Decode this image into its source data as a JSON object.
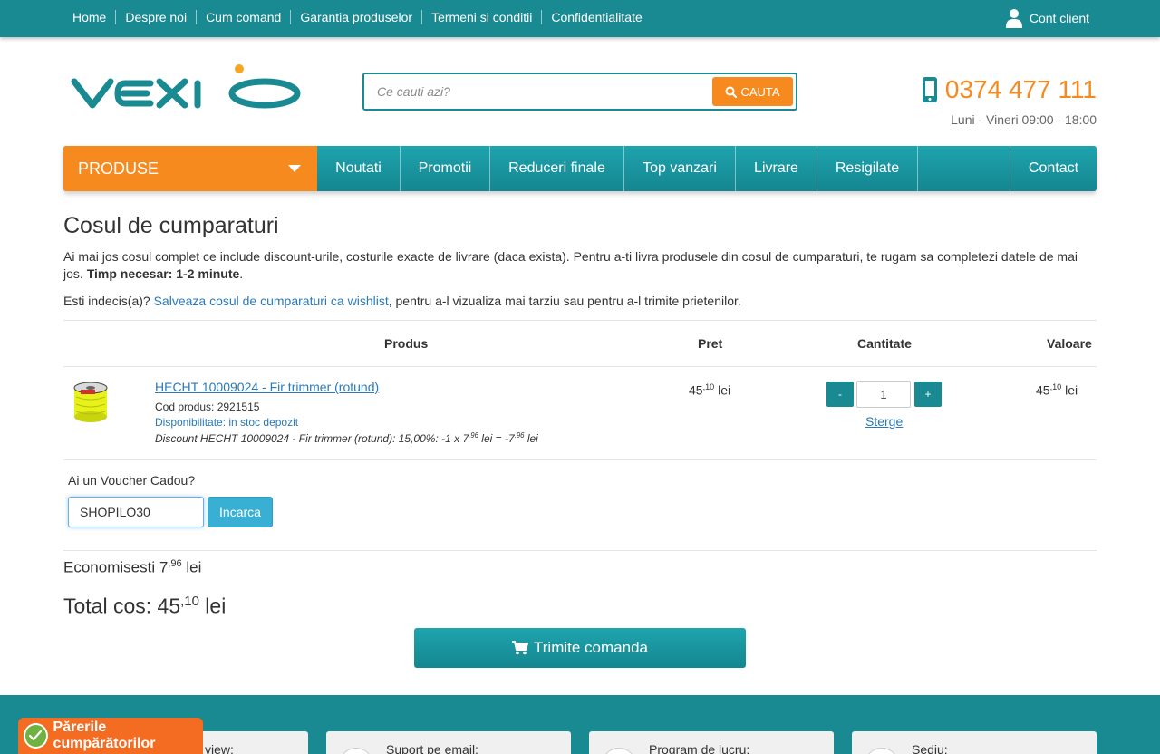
{
  "topnav": {
    "links": [
      "Home",
      "Despre noi",
      "Cum comand",
      "Garantia produselor",
      "Termeni si conditii",
      "Confidentialitate"
    ],
    "account": "Cont client"
  },
  "search": {
    "placeholder": "Ce cauti azi?",
    "button": "CAUTA"
  },
  "contact": {
    "phone": "0374 477 111",
    "hours": "Luni - Vineri 09:00 - 18:00"
  },
  "mainnav": {
    "products": "PRODUSE",
    "items": [
      "Noutati",
      "Promotii",
      "Reduceri finale",
      "Top vanzari",
      "Livrare",
      "Resigilate"
    ],
    "contact": "Contact"
  },
  "cart": {
    "title": "Cosul de cumparaturi",
    "intro": "Ai mai jos cosul complet ce include discount-urile, costurile exacte de livrare (daca exista). Pentru a-ti livra produsele din cosul de cumparaturi, te rugam sa completezi datele de mai jos.",
    "intro_bold": "Timp necesar: 1-2 minute",
    "wish_prefix": "Esti indecis(a)?",
    "wish_link": "Salveaza cosul de cumparaturi ca wishlist",
    "wish_suffix": ", pentru a-l vizualiza mai tarziu sau pentru a-l trimite prietenilor.",
    "headers": {
      "product": "Produs",
      "price": "Pret",
      "quantity": "Cantitate",
      "value": "Valoare"
    },
    "item": {
      "name": "HECHT 10009024 - Fir trimmer (rotund)",
      "code": "Cod produs: 2921515",
      "stock": "Disponibilitate: in stoc depozit",
      "discount_text": "Discount HECHT 10009024 - Fir trimmer (rotund): 15,00%: -1 x 7",
      "discount_sup1": ".96",
      "discount_mid": " lei = -7",
      "discount_sup2": ".96",
      "discount_end": " lei",
      "price_int": "45",
      "price_dec": ",10",
      "currency": " lei",
      "qty": "1",
      "minus": "-",
      "plus": "+",
      "remove": "Sterge",
      "value_int": "45",
      "value_dec": ",10"
    },
    "voucher": {
      "label": "Ai un Voucher Cadou?",
      "value": "SHOPILO30",
      "button": "Incarca"
    },
    "savings": {
      "label": "Economisesti 7",
      "dec": ",96",
      "currency": " lei"
    },
    "total": {
      "label": "Total cos: 45",
      "dec": ",10",
      "currency": " lei"
    },
    "submit": "Trimite comanda"
  },
  "footer": {
    "boxes": [
      "view:",
      "Suport pe email:",
      "Program de lucru:",
      "Sediu:"
    ]
  },
  "reviews_badge": "Părerile cumpărătorilor",
  "colors": {
    "teal": "#1a8a92",
    "orange": "#f68a1f",
    "link": "#2a7ab8"
  }
}
